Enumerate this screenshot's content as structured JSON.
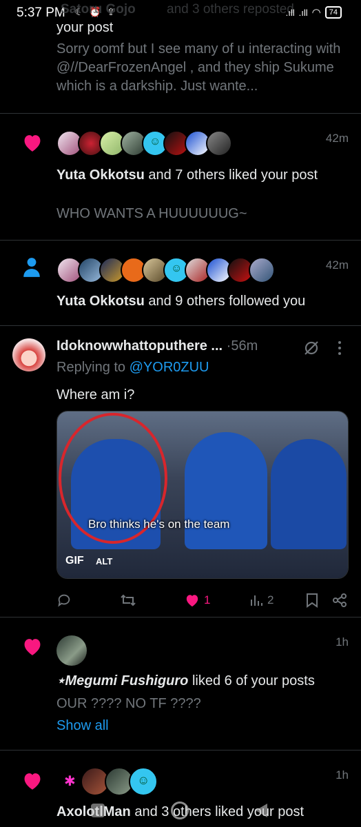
{
  "status": {
    "time": "5:37 PM",
    "battery": "74",
    "overlap_text_left": "Satoru Gojo",
    "overlap_text_right": "and 3 others reposted"
  },
  "notifications": [
    {
      "tail_text": "your post",
      "snippet": "Sorry oomf but I see many of u interacting with @//DearFrozenAngel , and they ship Sukume which is a darkship. Just wante..."
    },
    {
      "time": "42m",
      "actor": "Yuta Okkotsu",
      "action": "and 7 others liked your post",
      "snippet": "WHO WANTS A HUUUUUUG~"
    },
    {
      "time": "42m",
      "actor": "Yuta Okkotsu",
      "action": "and 9 others followed you"
    },
    {
      "display_name": "Idoknowwhattoputhere ...",
      "sep": "·",
      "time": "56m",
      "replying_prefix": "Replying to",
      "replying_to": "@YOR0ZUU",
      "body": "Where am i?",
      "media": {
        "caption": "Bro thinks he's on the team",
        "gif_label": "GIF",
        "alt_label": "ALT"
      },
      "likes": "1",
      "views": "2"
    },
    {
      "time": "1h",
      "actor": "⋆Megumi Fushiguro",
      "action": "liked 6 of your posts",
      "snippet": "OUR ???? NO TF ????",
      "show_all": "Show all"
    },
    {
      "time": "1h",
      "actor": "AxolotlMan",
      "action": "and 3 others liked your post"
    }
  ],
  "colors": {
    "like_pink": "#f91880",
    "follow_blue": "#1d9bf0",
    "muted": "#71767b",
    "divider": "#2f3336"
  },
  "icons": [
    "heart-icon",
    "person-icon",
    "reply-icon",
    "repost-icon",
    "views-icon",
    "bookmark-icon",
    "share-icon",
    "grok-icon",
    "more-icon"
  ]
}
